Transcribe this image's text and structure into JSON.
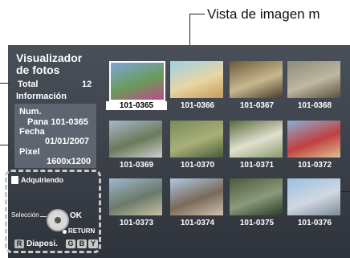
{
  "callout": {
    "title": "Vista de imagen m"
  },
  "sidebar": {
    "app_title_line1": "Visualizador",
    "app_title_line2": "de fotos",
    "total_label": "Total",
    "total_value": "12",
    "info_label": "Información",
    "num_label": "Num.",
    "num_value": "Pana 101-0365",
    "date_label": "Fecha",
    "date_value": "01/01/2007",
    "pixel_label": "Pixel",
    "pixel_value": "1600x1200",
    "acquiring_label": "Adquiriendo",
    "selection_label": "Selección",
    "ok_label": "OK",
    "return_label": "RETURN",
    "r_key": "R",
    "slideshow_label": "Diaposi.",
    "g_key": "G",
    "b_key": "B",
    "y_key": "Y"
  },
  "grid": {
    "items": [
      {
        "caption": "101-0365",
        "selected": true,
        "colors": [
          "#7ea6d8",
          "#6a9a5a",
          "#c04a8a"
        ]
      },
      {
        "caption": "101-0366",
        "selected": false,
        "colors": [
          "#9fd0e6",
          "#e8d6a2",
          "#c49a5a"
        ]
      },
      {
        "caption": "101-0367",
        "selected": false,
        "colors": [
          "#6a5a3a",
          "#c8b890",
          "#4a3a2a"
        ]
      },
      {
        "caption": "101-0368",
        "selected": false,
        "colors": [
          "#8a8a7a",
          "#c0b8a0",
          "#5a5040"
        ]
      },
      {
        "caption": "101-0369",
        "selected": false,
        "colors": [
          "#a8b8c8",
          "#6a7a5a",
          "#d0d0d0"
        ]
      },
      {
        "caption": "101-0370",
        "selected": false,
        "colors": [
          "#7a8a5a",
          "#a8b078",
          "#4a5a3a"
        ]
      },
      {
        "caption": "101-0371",
        "selected": false,
        "colors": [
          "#5a6a3a",
          "#e0e0d0",
          "#8a9a6a"
        ]
      },
      {
        "caption": "101-0372",
        "selected": false,
        "colors": [
          "#8ab0d8",
          "#c04040",
          "#e0c090"
        ]
      },
      {
        "caption": "101-0373",
        "selected": false,
        "colors": [
          "#a0b8d0",
          "#6a7a6a",
          "#c8c0a0"
        ]
      },
      {
        "caption": "101-0374",
        "selected": false,
        "colors": [
          "#b0c8e0",
          "#7a6a5a",
          "#d0c0b0"
        ]
      },
      {
        "caption": "101-0375",
        "selected": false,
        "colors": [
          "#4a5a3a",
          "#8a9a7a",
          "#2a3a2a"
        ]
      },
      {
        "caption": "101-0376",
        "selected": false,
        "colors": [
          "#9ac0e0",
          "#d0d8e0",
          "#7a8a9a"
        ]
      }
    ]
  }
}
